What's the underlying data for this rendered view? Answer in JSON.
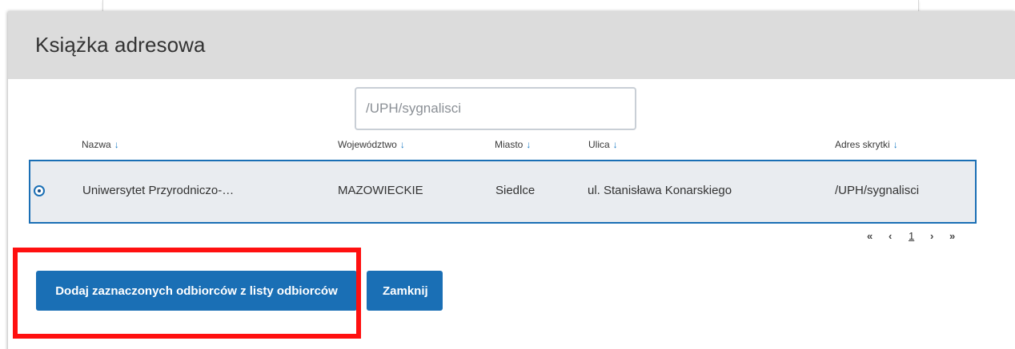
{
  "modal": {
    "title": "Książka adresowa"
  },
  "search": {
    "value": "/UPH/sygnalisci",
    "placeholder": ""
  },
  "table": {
    "columns": [
      {
        "label": "Nazwa",
        "sort_icon": "arrow-down-icon"
      },
      {
        "label": "Województwo",
        "sort_icon": "arrow-down-icon"
      },
      {
        "label": "Miasto",
        "sort_icon": "arrow-down-icon"
      },
      {
        "label": "Ulica",
        "sort_icon": "arrow-down-icon"
      },
      {
        "label": "Adres skrytki",
        "sort_icon": "arrow-down-icon"
      }
    ],
    "sort_arrow_glyph": "↓",
    "rows": [
      {
        "selected": true,
        "nazwa": "Uniwersytet Przyrodniczo-…",
        "wojewodztwo": "MAZOWIECKIE",
        "miasto": "Siedlce",
        "ulica": "ul. Stanisława Konarskiego",
        "adres_skrytki": "/UPH/sygnalisci"
      }
    ]
  },
  "pagination": {
    "first": "«",
    "prev": "‹",
    "current_page": "1",
    "next": "›",
    "last": "»"
  },
  "actions": {
    "add_label": "Dodaj zaznaczonych odbiorców z listy odbiorców",
    "close_label": "Zamknij"
  },
  "colors": {
    "primary": "#1a6fb5",
    "header_bg": "#dcdcdc",
    "row_bg": "#e9ecf0",
    "highlight": "#ff1010",
    "sort_arrow": "#1a7bc4"
  }
}
